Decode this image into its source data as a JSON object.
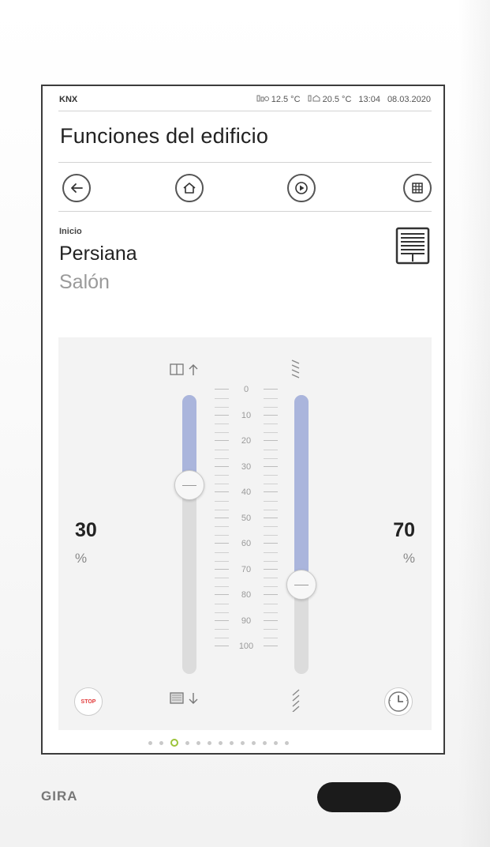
{
  "status_bar": {
    "left": "KNX",
    "outdoor_temp": "12.5 °C",
    "indoor_temp": "20.5 °C",
    "time": "13:04",
    "date": "08.03.2020"
  },
  "header": {
    "title": "Funciones del edificio"
  },
  "nav": [
    {
      "name": "back",
      "icon": "back-arrow-icon"
    },
    {
      "name": "home",
      "icon": "home-icon"
    },
    {
      "name": "scenes",
      "icon": "play-scene-icon"
    },
    {
      "name": "grid",
      "icon": "grid-icon"
    }
  ],
  "page": {
    "breadcrumb": "Inicio",
    "device_name": "Persiana",
    "room": "Salón",
    "device_icon": "blind-icon"
  },
  "controls": {
    "position": {
      "value": "30",
      "unit": "%",
      "level": 30
    },
    "slats": {
      "value": "70",
      "unit": "%",
      "level": 70
    },
    "scale": [
      "0",
      "10",
      "20",
      "30",
      "40",
      "50",
      "60",
      "70",
      "80",
      "90",
      "100"
    ],
    "top_left_icon": "blind-open-up-icon",
    "bottom_left_icon": "blind-closed-down-icon",
    "top_right_icon": "slats-open-icon",
    "bottom_right_icon": "slats-closed-icon",
    "stop_label": "STOP",
    "timer_icon": "clock-icon"
  },
  "pager": {
    "count": 13,
    "active": 3
  },
  "device": {
    "brand": "GIRA"
  }
}
